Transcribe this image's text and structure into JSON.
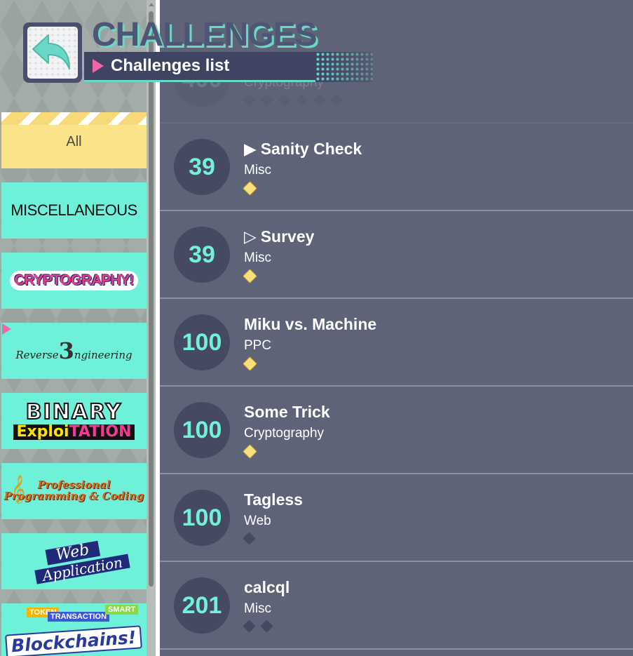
{
  "header": {
    "title": "CHALLENGES",
    "subtitle": "Challenges list"
  },
  "categories": [
    {
      "id": "all",
      "label": "All"
    },
    {
      "id": "misc",
      "label": "MISCELLANEOUS"
    },
    {
      "id": "crypto",
      "label": "CRYPTOGRAPHY!"
    },
    {
      "id": "rev",
      "label_a": "Reverse",
      "label_b": "ngineering",
      "label_mark": "3"
    },
    {
      "id": "pwn",
      "label_a": "BINARY",
      "label_b": "Exploi",
      "label_c": "TATION"
    },
    {
      "id": "ppc",
      "label": "Professional Programming & Coding"
    },
    {
      "id": "web",
      "label_a": "Web",
      "label_b": "Application"
    },
    {
      "id": "blockchain",
      "label": "Blockchains!",
      "tags": [
        "TOKEN",
        "TRANSACTION",
        "SMART"
      ]
    }
  ],
  "challenges": [
    {
      "score": "400",
      "name": "",
      "category": "Cryptography",
      "difficulty_filled": 0,
      "difficulty_total": 6,
      "faded": true
    },
    {
      "score": "39",
      "name": "Sanity Check",
      "marker": "▶",
      "category": "Misc",
      "difficulty_filled": 1,
      "difficulty_total": 1
    },
    {
      "score": "39",
      "name": "Survey",
      "marker": "▷",
      "category": "Misc",
      "difficulty_filled": 1,
      "difficulty_total": 1
    },
    {
      "score": "100",
      "name": "Miku vs. Machine",
      "marker": "",
      "category": "PPC",
      "difficulty_filled": 1,
      "difficulty_total": 1,
      "selected": true
    },
    {
      "score": "100",
      "name": "Some Trick",
      "marker": "",
      "category": "Cryptography",
      "difficulty_filled": 1,
      "difficulty_total": 1
    },
    {
      "score": "100",
      "name": "Tagless",
      "marker": "",
      "category": "Web",
      "difficulty_filled": 0,
      "difficulty_total": 1
    },
    {
      "score": "201",
      "name": "calcql",
      "marker": "",
      "category": "Misc",
      "difficulty_filled": 0,
      "difficulty_total": 2
    }
  ],
  "colors": {
    "accent": "#6ad8c6",
    "pink": "#f266a8",
    "list_bg": "#5f6378",
    "score_text": "#72f0d8",
    "category_bg": "#6ff0d8",
    "all_bg": "#fbe38a"
  },
  "icons": {
    "back": "back-arrow-icon",
    "difficulty": "diamond-icon"
  }
}
